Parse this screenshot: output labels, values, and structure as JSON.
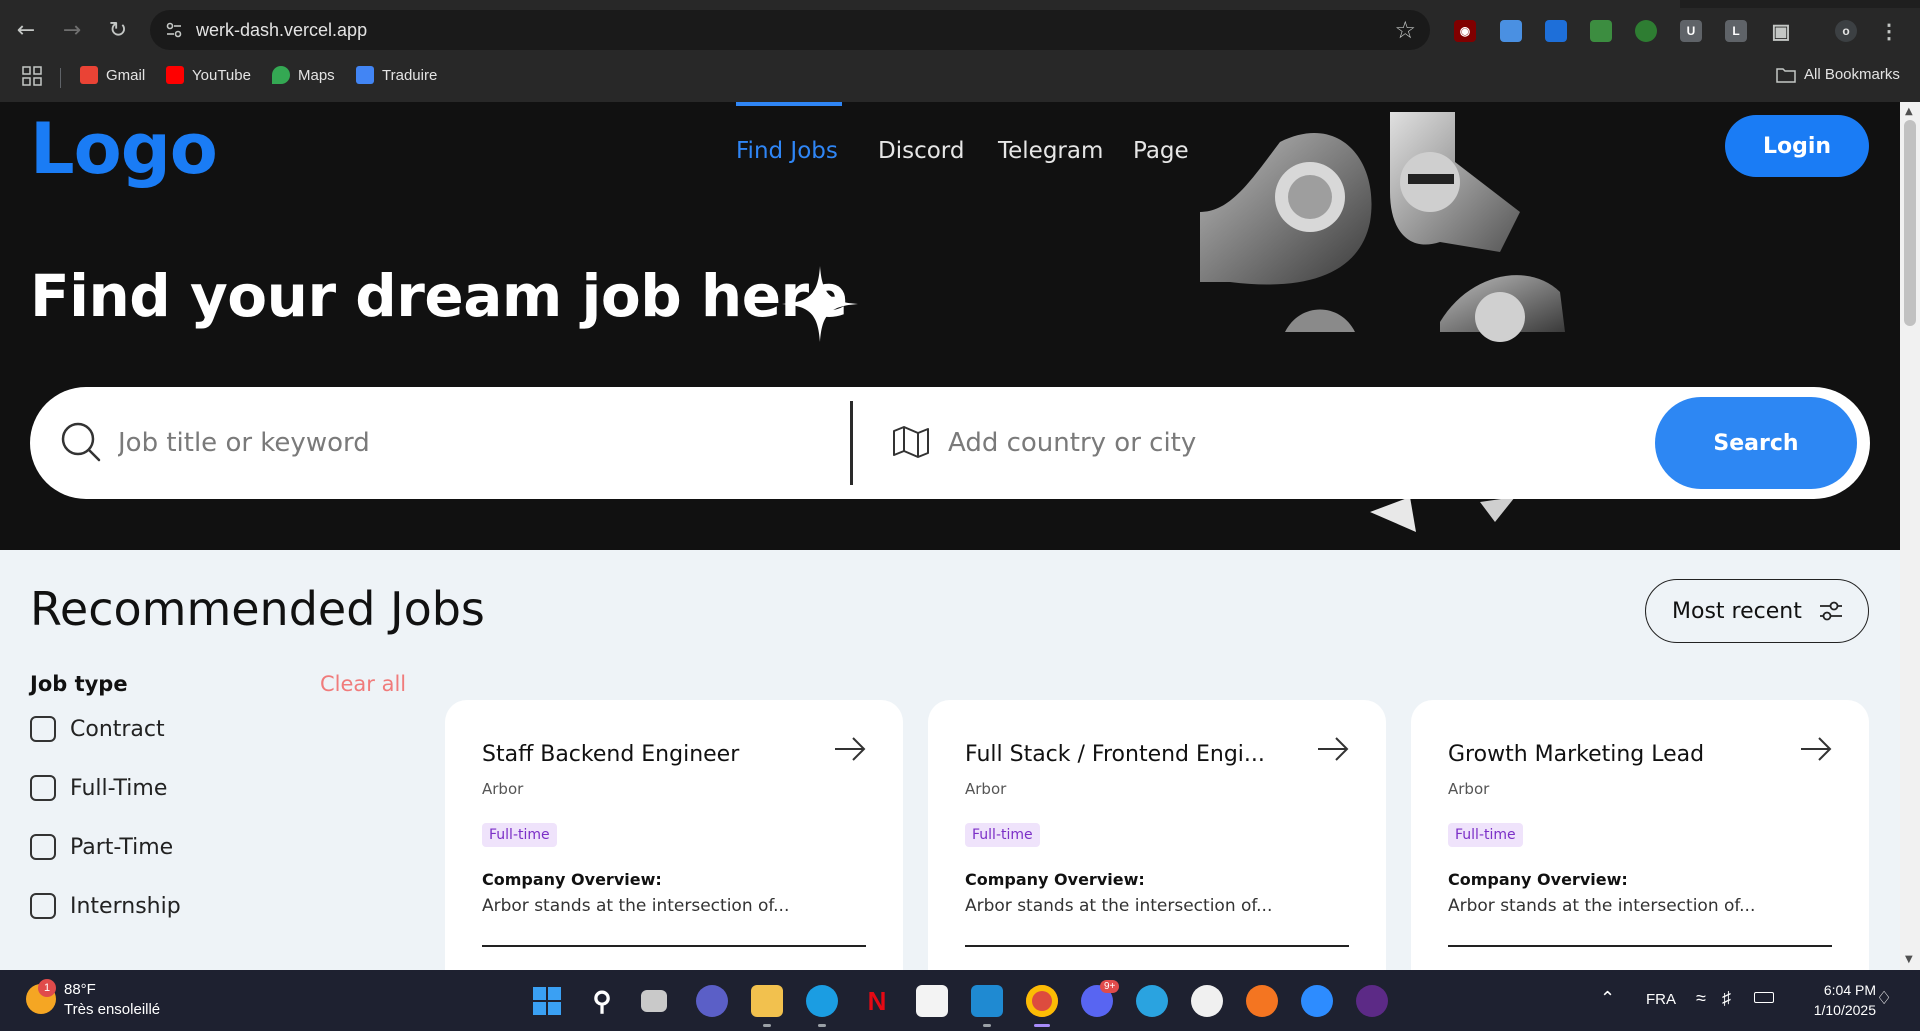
{
  "browser": {
    "url": "werk-dash.vercel.app",
    "bookmarks": [
      {
        "label": "Gmail",
        "color": "#ea4335"
      },
      {
        "label": "YouTube",
        "color": "#ff0000"
      },
      {
        "label": "Maps",
        "color": "#34a853"
      },
      {
        "label": "Traduire",
        "color": "#4285f4"
      }
    ],
    "all_bookmarks": "All Bookmarks",
    "extensions": [
      "uBlock",
      "ext-2",
      "ext-3",
      "ext-4",
      "ext-5",
      "U",
      "L"
    ],
    "profile_initial": "o"
  },
  "header": {
    "logo": "Logo",
    "nav": [
      {
        "label": "Find Jobs",
        "active": true
      },
      {
        "label": "Discord",
        "active": false
      },
      {
        "label": "Telegram",
        "active": false
      },
      {
        "label": "Page",
        "active": false
      }
    ],
    "login": "Login",
    "accent": "#1a7cf5"
  },
  "hero": {
    "headline": "Find your dream job here",
    "search": {
      "keyword_placeholder": "Job title or keyword",
      "location_placeholder": "Add country or city",
      "button": "Search"
    }
  },
  "section": {
    "title": "Recommended Jobs",
    "sort_label": "Most recent"
  },
  "filters": {
    "heading": "Job type",
    "clear": "Clear all",
    "options": [
      "Contract",
      "Full-Time",
      "Part-Time",
      "Internship"
    ]
  },
  "jobs": [
    {
      "title": "Staff Backend Engineer",
      "company": "Arbor",
      "type": "Full-time",
      "overview_label": "Company Overview:",
      "overview": "Arbor stands at the intersection of..."
    },
    {
      "title": "Full Stack / Frontend Engi...",
      "company": "Arbor",
      "type": "Full-time",
      "overview_label": "Company Overview:",
      "overview": "Arbor stands at the intersection of..."
    },
    {
      "title": "Growth Marketing Lead",
      "company": "Arbor",
      "type": "Full-time",
      "overview_label": "Company Overview:",
      "overview": "Arbor stands at the intersection of..."
    }
  ],
  "taskbar": {
    "weather_temp": "88°F",
    "weather_desc": "Très ensoleillé",
    "weather_badge": "1",
    "language": "FRA",
    "time": "6:04 PM",
    "date": "1/10/2025",
    "discord_badge": "9+",
    "apps": [
      "start-icon",
      "search-icon",
      "task-view-icon",
      "teams-icon",
      "file-explorer-icon",
      "edge-icon",
      "netflix-icon",
      "store-icon",
      "vscode-icon",
      "chrome-icon",
      "discord-icon",
      "telegram-icon",
      "mongodb-icon",
      "crunchyroll-icon",
      "zoom-icon",
      "pi-icon"
    ]
  }
}
